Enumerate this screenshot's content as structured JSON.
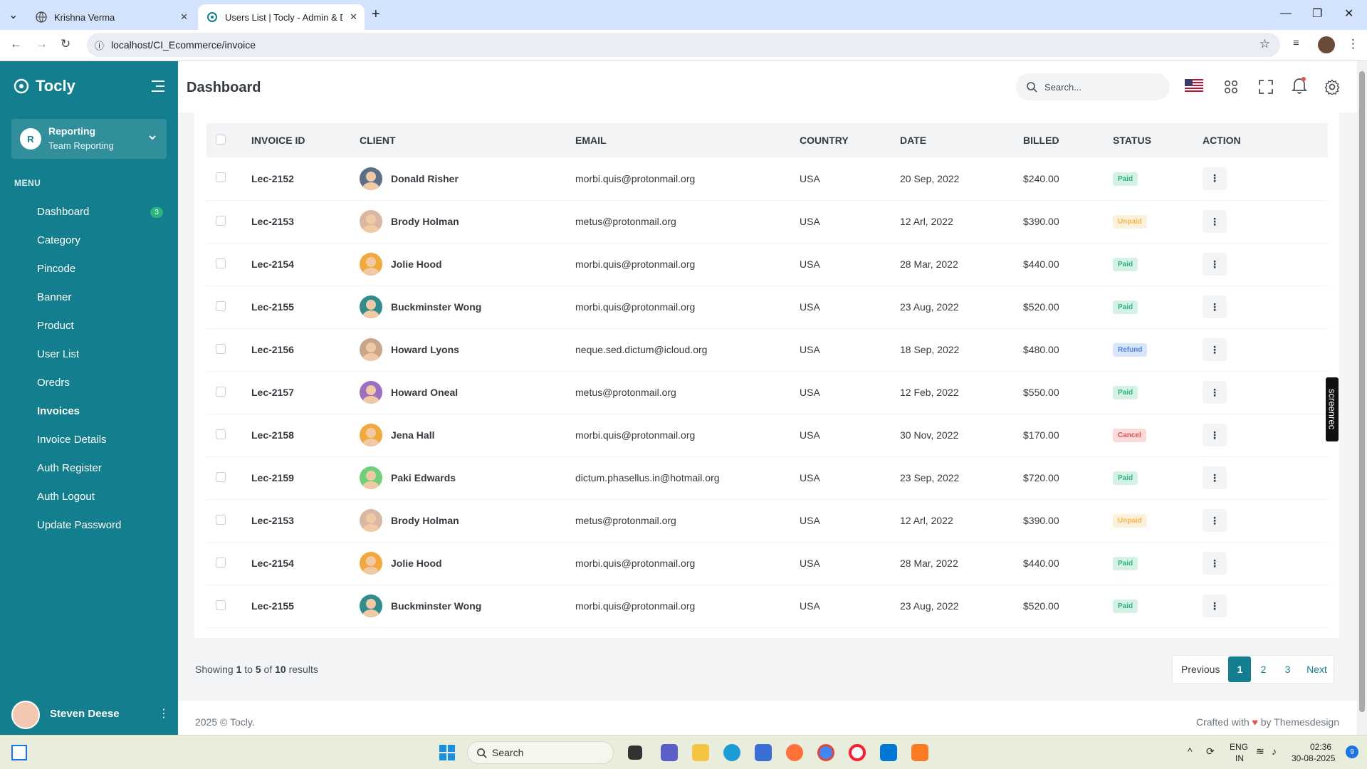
{
  "browser": {
    "tabs": [
      {
        "title": "Krishna Verma"
      },
      {
        "title": "Users List | Tocly - Admin & Da"
      }
    ],
    "url": "localhost/CI_Ecommerce/invoice"
  },
  "sidebar": {
    "brand": "Tocly",
    "team": {
      "initial": "R",
      "name": "Reporting",
      "sub": "Team Reporting"
    },
    "menu_label": "MENU",
    "items": [
      {
        "label": "Dashboard",
        "badge": "3"
      },
      {
        "label": "Category"
      },
      {
        "label": "Pincode"
      },
      {
        "label": "Banner"
      },
      {
        "label": "Product"
      },
      {
        "label": "User List"
      },
      {
        "label": "Oredrs"
      },
      {
        "label": "Invoices"
      },
      {
        "label": "Invoice Details"
      },
      {
        "label": "Auth Register"
      },
      {
        "label": "Auth Logout"
      },
      {
        "label": "Update Password"
      }
    ],
    "user": {
      "name": "Steven Deese"
    }
  },
  "header": {
    "title": "Dashboard",
    "search_placeholder": "Search..."
  },
  "table": {
    "columns": [
      "INVOICE ID",
      "CLIENT",
      "EMAIL",
      "COUNTRY",
      "DATE",
      "BILLED",
      "STATUS",
      "ACTION"
    ],
    "rows": [
      {
        "id": "Lec-2152",
        "client": "Donald Risher",
        "email": "morbi.quis@protonmail.org",
        "country": "USA",
        "date": "20 Sep, 2022",
        "billed": "$240.00",
        "status": "Paid",
        "avatar_color": "#5b6f8a"
      },
      {
        "id": "Lec-2153",
        "client": "Brody Holman",
        "email": "metus@protonmail.org",
        "country": "USA",
        "date": "12 Arl, 2022",
        "billed": "$390.00",
        "status": "Unpaid",
        "avatar_color": "#d9b7a0"
      },
      {
        "id": "Lec-2154",
        "client": "Jolie Hood",
        "email": "morbi.quis@protonmail.org",
        "country": "USA",
        "date": "28 Mar, 2022",
        "billed": "$440.00",
        "status": "Paid",
        "avatar_color": "#f2a93b"
      },
      {
        "id": "Lec-2155",
        "client": "Buckminster Wong",
        "email": "morbi.quis@protonmail.org",
        "country": "USA",
        "date": "23 Aug, 2022",
        "billed": "$520.00",
        "status": "Paid",
        "avatar_color": "#2f8d8d"
      },
      {
        "id": "Lec-2156",
        "client": "Howard Lyons",
        "email": "neque.sed.dictum@icloud.org",
        "country": "USA",
        "date": "18 Sep, 2022",
        "billed": "$480.00",
        "status": "Refund",
        "avatar_color": "#c9a58a"
      },
      {
        "id": "Lec-2157",
        "client": "Howard Oneal",
        "email": "metus@protonmail.org",
        "country": "USA",
        "date": "12 Feb, 2022",
        "billed": "$550.00",
        "status": "Paid",
        "avatar_color": "#9a6fc4"
      },
      {
        "id": "Lec-2158",
        "client": "Jena Hall",
        "email": "morbi.quis@protonmail.org",
        "country": "USA",
        "date": "30 Nov, 2022",
        "billed": "$170.00",
        "status": "Cancel",
        "avatar_color": "#f2a93b"
      },
      {
        "id": "Lec-2159",
        "client": "Paki Edwards",
        "email": "dictum.phasellus.in@hotmail.org",
        "country": "USA",
        "date": "23 Sep, 2022",
        "billed": "$720.00",
        "status": "Paid",
        "avatar_color": "#6fcf7a"
      },
      {
        "id": "Lec-2153",
        "client": "Brody Holman",
        "email": "metus@protonmail.org",
        "country": "USA",
        "date": "12 Arl, 2022",
        "billed": "$390.00",
        "status": "Unpaid",
        "avatar_color": "#d9b7a0"
      },
      {
        "id": "Lec-2154",
        "client": "Jolie Hood",
        "email": "morbi.quis@protonmail.org",
        "country": "USA",
        "date": "28 Mar, 2022",
        "billed": "$440.00",
        "status": "Paid",
        "avatar_color": "#f2a93b"
      },
      {
        "id": "Lec-2155",
        "client": "Buckminster Wong",
        "email": "morbi.quis@protonmail.org",
        "country": "USA",
        "date": "23 Aug, 2022",
        "billed": "$520.00",
        "status": "Paid",
        "avatar_color": "#2f8d8d"
      }
    ]
  },
  "pagination": {
    "showing_prefix": "Showing",
    "from": "1",
    "to_word": "to",
    "to": "5",
    "of_word": "of",
    "total": "10",
    "suffix": "results",
    "previous": "Previous",
    "pages": [
      "1",
      "2",
      "3"
    ],
    "next": "Next"
  },
  "footer": {
    "copyright": "2025 © Tocly.",
    "crafted_prefix": "Crafted with",
    "crafted_suffix": "by Themesdesign"
  },
  "screenrec": "screenrec",
  "taskbar": {
    "search": "Search",
    "lang": "ENG",
    "region": "IN",
    "time": "02:36",
    "date": "30-08-2025",
    "notif": "9"
  },
  "colors": {
    "accent": "#137f8e",
    "paid": "#2ab57d",
    "unpaid": "#f6b54c",
    "refund": "#4a86e0",
    "cancel": "#e05353"
  }
}
